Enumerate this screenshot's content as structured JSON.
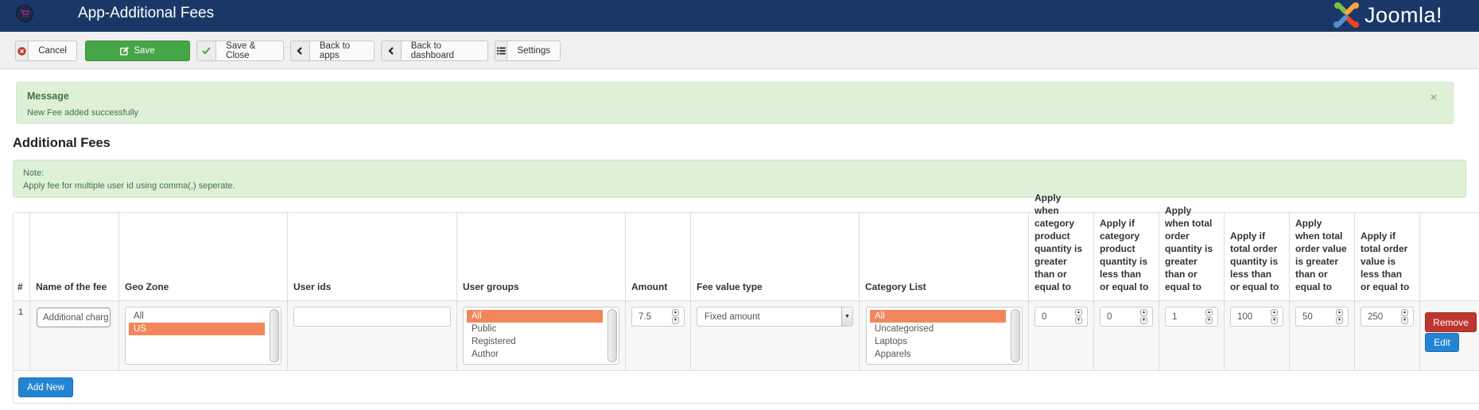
{
  "header": {
    "app_icon": "shopping-cart-icon",
    "title": "App-Additional Fees",
    "brand": "Joomla!",
    "brand_reg": "®"
  },
  "toolbar": {
    "cancel": {
      "label": "Cancel",
      "icon": "cancel-circle-icon"
    },
    "save": {
      "label": "Save",
      "icon": "edit-icon"
    },
    "save_close": {
      "label": "Save & Close",
      "icon": "checkmark-icon"
    },
    "back_apps": {
      "label": "Back to apps",
      "icon": "chevron-left-icon"
    },
    "back_dashboard": {
      "label": "Back to dashboard",
      "icon": "chevron-left-icon"
    },
    "settings": {
      "label": "Settings",
      "icon": "list-icon"
    }
  },
  "message": {
    "heading": "Message",
    "text": "New Fee added successfully",
    "close": "×"
  },
  "page_title": "Additional Fees",
  "note": {
    "label": "Note:",
    "text": "Apply fee for multiple user id using comma(,) seperate."
  },
  "table": {
    "columns": [
      "#",
      "Name of the fee",
      "Geo Zone",
      "User ids",
      "User groups",
      "Amount",
      "Fee value type",
      "Category List",
      "Apply when category product quantity is greater than or equal to",
      "Apply if category product quantity is less than or equal to",
      "Apply when total order quantity is greater than or equal to",
      "Apply if total order quantity is less than or equal to",
      "Apply when total order value is greater than or equal to",
      "Apply if total order value is less than or equal to"
    ],
    "rows": [
      {
        "index": "1",
        "name": "Additional charg",
        "geo_zone": {
          "options": [
            "All",
            "US"
          ],
          "selected": "US"
        },
        "user_ids": "",
        "user_groups": {
          "options": [
            "All",
            "Public",
            "Registered",
            "Author"
          ],
          "selected": "All"
        },
        "amount": "7.5",
        "fee_value_type": "Fixed amount",
        "category_list": {
          "options": [
            "All",
            "Uncategorised",
            "Laptops",
            "Apparels"
          ],
          "selected": "All"
        },
        "cat_qty_min": "0",
        "cat_qty_max": "0",
        "order_qty_min": "1",
        "order_qty_max": "100",
        "order_value_min": "50",
        "order_value_max": "250"
      }
    ],
    "remove_label": "Remove",
    "edit_label": "Edit",
    "add_new_label": "Add New"
  }
}
